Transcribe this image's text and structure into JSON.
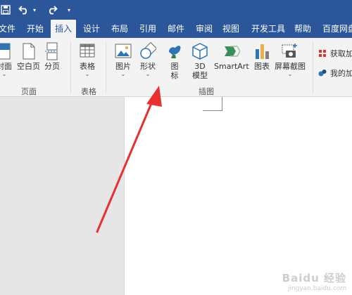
{
  "quick_access": {
    "save_icon": "save-icon",
    "undo_icon": "undo-icon",
    "undo_dropdown": "▾",
    "redo_icon": "redo-icon",
    "customize": "▾"
  },
  "tabs": [
    {
      "label": "文件",
      "active": false
    },
    {
      "label": "开始",
      "active": false
    },
    {
      "label": "插入",
      "active": true
    },
    {
      "label": "设计",
      "active": false
    },
    {
      "label": "布局",
      "active": false
    },
    {
      "label": "引用",
      "active": false
    },
    {
      "label": "邮件",
      "active": false
    },
    {
      "label": "审阅",
      "active": false
    },
    {
      "label": "视图",
      "active": false
    },
    {
      "label": "开发工具",
      "active": false
    },
    {
      "label": "帮助",
      "active": false
    },
    {
      "label": "百度网盘",
      "active": false
    }
  ],
  "ribbon": {
    "pages_group": {
      "label": "页面",
      "cover": "封面",
      "blank_page": "空白页",
      "page_break": "分页"
    },
    "tables_group": {
      "label": "表格",
      "table": "表格"
    },
    "illustrations_group": {
      "label": "插图",
      "pictures": "图片",
      "shapes": "形状",
      "icons_line1": "图",
      "icons_line2": "标",
      "models_line1": "3D",
      "models_line2": "模型",
      "smartart": "SmartArt",
      "chart": "图表",
      "screenshot": "屏幕截图"
    },
    "addins_group": {
      "get_addins": "获取加",
      "my_addins": "我的加"
    },
    "dropdown_glyph": "⌄"
  },
  "watermark": {
    "brand": "Baidu 经验",
    "url": "jingyan.baidu.com"
  },
  "colors": {
    "title_blue": "#2b579a",
    "ribbon_bg": "#f3f3f3",
    "arrow_red": "#e8312f"
  }
}
